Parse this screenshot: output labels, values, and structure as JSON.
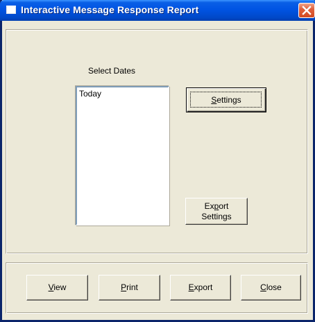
{
  "window": {
    "title": "Interactive Message Response Report"
  },
  "dates": {
    "label": "Select Dates",
    "items": [
      "Today"
    ]
  },
  "buttons": {
    "settings": {
      "mnemonic": "S",
      "rest": "ettings"
    },
    "export_settings": {
      "line1_pre": "Ex",
      "line1_mnemonic": "p",
      "line1_post": "ort",
      "line2": "Settings"
    },
    "view": {
      "mnemonic": "V",
      "rest": "iew"
    },
    "print": {
      "mnemonic": "P",
      "rest": "rint"
    },
    "export": {
      "mnemonic": "E",
      "rest": "xport"
    },
    "close": {
      "mnemonic": "C",
      "rest": "lose"
    }
  },
  "icons": {
    "app": "window-icon",
    "close": "close-icon"
  },
  "colors": {
    "titlebar": "#0054E3",
    "face": "#ECE9D8",
    "close_button": "#D14A22"
  }
}
